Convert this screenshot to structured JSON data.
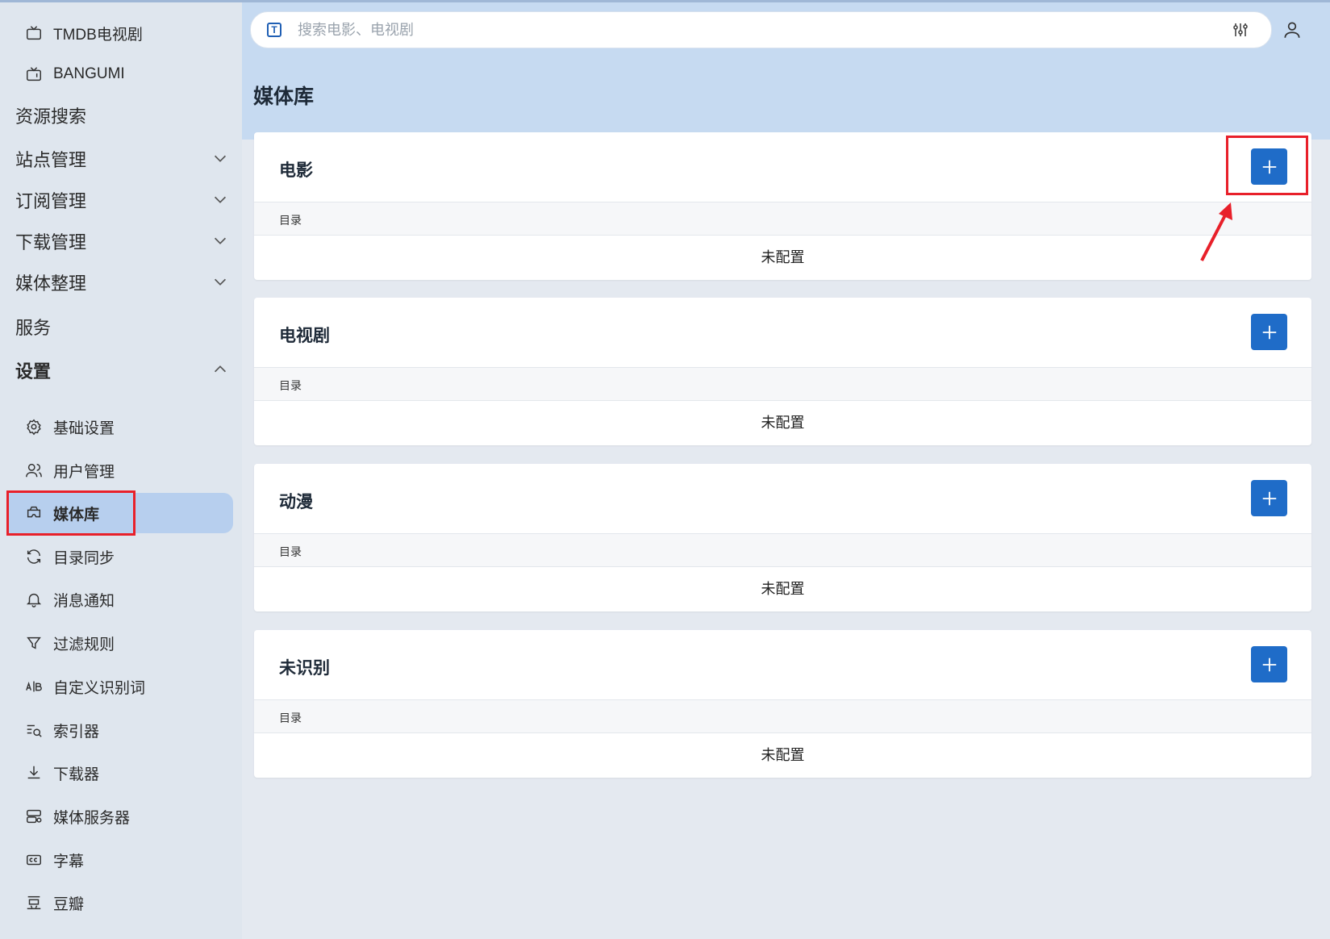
{
  "sidebar": {
    "top_items": [
      {
        "label": "TMDB电视剧",
        "icon": "tv-icon"
      },
      {
        "label": "BANGUMI",
        "icon": "tv-retro-icon"
      }
    ],
    "sections": [
      {
        "label": "资源搜索"
      },
      {
        "label": "站点管理",
        "icon": "chevron-down-icon"
      },
      {
        "label": "订阅管理",
        "icon": "chevron-down-icon"
      },
      {
        "label": "下载管理",
        "icon": "chevron-down-icon"
      },
      {
        "label": "媒体整理",
        "icon": "chevron-down-icon"
      },
      {
        "label": "服务"
      },
      {
        "label": "设置",
        "icon": "chevron-up-icon"
      }
    ],
    "settings_items": [
      {
        "label": "基础设置",
        "icon": "gear-icon"
      },
      {
        "label": "用户管理",
        "icon": "users-icon"
      },
      {
        "label": "媒体库",
        "icon": "vr-icon",
        "active": true
      },
      {
        "label": "目录同步",
        "icon": "sync-icon"
      },
      {
        "label": "消息通知",
        "icon": "bell-icon"
      },
      {
        "label": "过滤规则",
        "icon": "filter-icon"
      },
      {
        "label": "自定义识别词",
        "icon": "ab-icon"
      },
      {
        "label": "索引器",
        "icon": "list-search-icon"
      },
      {
        "label": "下载器",
        "icon": "download-icon"
      },
      {
        "label": "媒体服务器",
        "icon": "server-icon"
      },
      {
        "label": "字幕",
        "icon": "cc-icon"
      },
      {
        "label": "豆瓣",
        "icon": "douban-icon"
      }
    ]
  },
  "search": {
    "placeholder": "搜索电影、电视剧"
  },
  "page": {
    "title": "媒体库"
  },
  "cards": [
    {
      "title": "电影",
      "column": "目录",
      "empty": "未配置"
    },
    {
      "title": "电视剧",
      "column": "目录",
      "empty": "未配置"
    },
    {
      "title": "动漫",
      "column": "目录",
      "empty": "未配置"
    },
    {
      "title": "未识别",
      "column": "目录",
      "empty": "未配置"
    }
  ],
  "colors": {
    "accent": "#1f6cc8",
    "highlight": "#e8202a",
    "active_bg": "#b7cfee"
  }
}
